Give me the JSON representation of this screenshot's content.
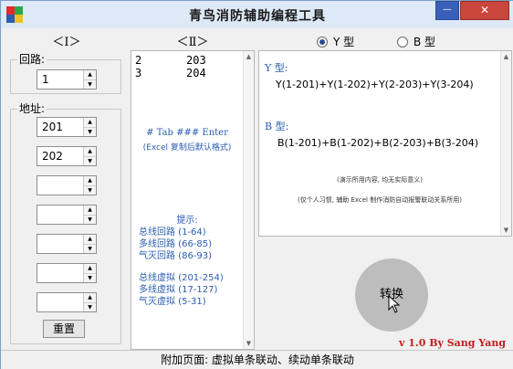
{
  "window": {
    "title": "青鸟消防辅助编程工具",
    "minimize_label": "—",
    "close_label": "✕",
    "icon_colors": [
      "#e02b2b",
      "#2aa84a",
      "#2a5db0",
      "#f0c020"
    ]
  },
  "tabs": {
    "left_header": "＜Ⅰ＞",
    "mid_header": "＜Ⅱ＞"
  },
  "radios": {
    "y_label": "Y 型",
    "y_selected": true,
    "b_label": "B 型",
    "b_selected": false
  },
  "loop": {
    "label": "回路:",
    "value": "1"
  },
  "address": {
    "label": "地址:",
    "values": [
      "201",
      "202",
      "",
      "",
      "",
      "",
      ""
    ]
  },
  "reset_label": "重置",
  "list": {
    "rows": [
      {
        "col1": "2",
        "col2": "203"
      },
      {
        "col1": "3",
        "col2": "204"
      }
    ],
    "format_line": "#  Tab  ###  Enter",
    "format_note": "(Excel 复制后默认格式)",
    "tips_title": "提示:",
    "tips_a": [
      "总线回路  (1-64)",
      "多线回路  (66-85)",
      "气灭回路  (86-93)"
    ],
    "tips_b": [
      "总线虚拟  (201-254)",
      "多线虚拟  (17-127)",
      "气灭虚拟  (5-31)"
    ]
  },
  "output": {
    "y_label": "Y 型:",
    "y_expr": "Y(1-201)+Y(1-202)+Y(2-203)+Y(3-204)",
    "b_label": "B 型:",
    "b_expr": "B(1-201)+B(1-202)+B(2-203)+B(3-204)",
    "note1": "(演示所用内容, 均无实际意义)",
    "note2": "(仅个人习惯, 辅助 Excel 制作消防自动报警联动关系所用)"
  },
  "convert_label": "转换",
  "version": "v 1.0 By Sang Yang",
  "status": "附加页面: 虚拟单条联动、续动单条联动",
  "colors": {
    "accent_blue": "#2a5db0",
    "version_red": "#c02020",
    "close_red": "#c9463d"
  }
}
